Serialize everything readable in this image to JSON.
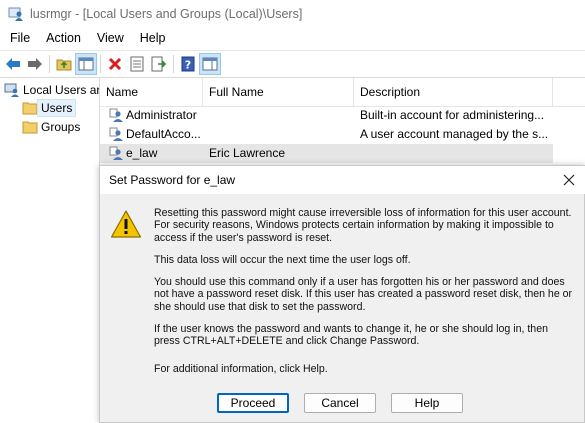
{
  "window": {
    "title": "lusrmgr - [Local Users and Groups (Local)\\Users]",
    "app_icon": "users-mmc-icon"
  },
  "menu": [
    "File",
    "Action",
    "View",
    "Help"
  ],
  "toolbar": {
    "buttons": [
      "back-arrow-icon",
      "forward-arrow-icon",
      "up-folder-icon",
      "show-hide-tree-icon",
      "delete-x-icon",
      "properties-icon",
      "export-list-icon",
      "help-icon",
      "show-hide-action-pane-icon"
    ]
  },
  "tree": {
    "root": "Local Users ar",
    "items": [
      {
        "label": "Users",
        "selected": true
      },
      {
        "label": "Groups",
        "selected": false
      }
    ]
  },
  "list": {
    "columns": [
      "Name",
      "Full Name",
      "Description"
    ],
    "rows": [
      {
        "name": "Administrator",
        "full_name": "",
        "description": "Built-in account for administering..."
      },
      {
        "name": "DefaultAcco...",
        "full_name": "",
        "description": "A user account managed by the s..."
      },
      {
        "name": "e_law",
        "full_name": "Eric Lawrence",
        "description": ""
      }
    ]
  },
  "dialog": {
    "title": "Set Password for e_law",
    "paragraphs": [
      [
        "Resetting this password might cause irreversible loss of information for this user account.",
        "For security reasons, Windows protects certain information by making it impossible to",
        "access if the user's password is reset."
      ],
      [
        "This data loss will occur the next time the user logs off."
      ],
      [
        "You should use this command only if a user has forgotten his or her password and does",
        "not have a password reset disk. If this user has created a password reset disk, then he or",
        "she should use that disk to set the password."
      ],
      [
        "If the user knows the password and wants to change it, he or she should log in, then",
        "press CTRL+ALT+DELETE and click Change Password."
      ],
      [
        "For additional information, click Help."
      ]
    ],
    "buttons": {
      "proceed": "Proceed",
      "cancel": "Cancel",
      "help": "Help"
    },
    "accent_color": "#0067c0",
    "warning_color": "#f5c400"
  }
}
